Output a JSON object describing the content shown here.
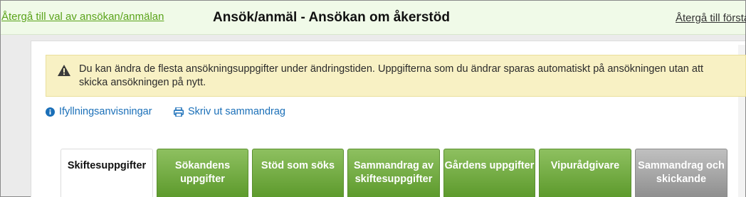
{
  "header": {
    "back_to_choice": "Återgå till val av ansökan/anmälan",
    "title": "Ansök/anmäl - Ansökan om åkerstöd",
    "back_to_first": "Återgå till första"
  },
  "alert": {
    "icon": "warning-icon",
    "text": "Du kan ändra de flesta ansökningsuppgifter under ändringstiden. Uppgifterna som du ändrar sparas automatiskt på ansökningen utan att skicka ansökningen på nytt."
  },
  "links": {
    "help": {
      "icon": "info-icon",
      "label": "Ifyllningsanvisningar"
    },
    "print": {
      "icon": "printer-icon",
      "label": "Skriv ut sammandrag"
    }
  },
  "tabs": [
    {
      "label": "Skiftesuppgifter",
      "state": "active"
    },
    {
      "label": "Sökandens uppgifter",
      "state": "green"
    },
    {
      "label": "Stöd som söks",
      "state": "green"
    },
    {
      "label": "Sammandrag av skiftesuppgifter",
      "state": "green"
    },
    {
      "label": "Gårdens uppgifter",
      "state": "green"
    },
    {
      "label": "Vipurådgivare",
      "state": "green"
    },
    {
      "label": "Sammandrag och skickande",
      "state": "gray"
    }
  ],
  "colors": {
    "link_green": "#5aa31a",
    "link_blue": "#1a6fb8",
    "tab_green": "#6ea83c",
    "tab_gray": "#a6a6a6",
    "alert_bg": "#f8f1c4"
  }
}
